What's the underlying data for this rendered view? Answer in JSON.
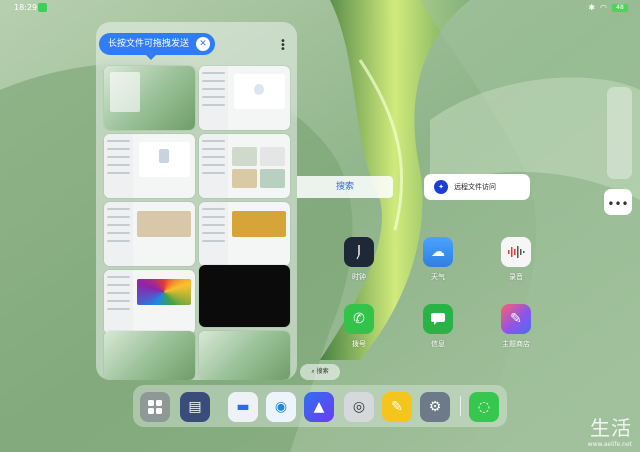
{
  "status_bar": {
    "time": "18:29",
    "battery": "48"
  },
  "file_panel": {
    "tooltip": "长按文件可拖拽发送",
    "close_symbol": "✕",
    "more_symbol": "⋮"
  },
  "search_top": "搜索",
  "remote_access": "远程文件访问",
  "apps": [
    {
      "label": "时钟",
      "icon": "clock-icon",
      "color": "#1f2837"
    },
    {
      "label": "天气",
      "icon": "weather-icon",
      "color": "#3c8ff0"
    },
    {
      "label": "录音",
      "icon": "recorder-icon",
      "color": "#f6f6f6"
    },
    {
      "label": "拨号",
      "icon": "phone-icon",
      "color": "#33c24a"
    },
    {
      "label": "信息",
      "icon": "message-icon",
      "color": "#28b347"
    },
    {
      "label": "主题商店",
      "icon": "theme-store-icon",
      "color": "#9d4ff0"
    }
  ],
  "search_pill": "搜索",
  "dock": [
    {
      "icon": "app-drawer-icon",
      "color": "#8e9896"
    },
    {
      "icon": "file-manager-icon",
      "color": "#3a4c7a"
    },
    {
      "icon": "files-icon",
      "color": "#eef2f6"
    },
    {
      "icon": "browser-icon",
      "color": "#eef4fb"
    },
    {
      "icon": "gallery-icon",
      "color": "#2f6ff3"
    },
    {
      "icon": "camera-icon",
      "color": "#d6d9dc"
    },
    {
      "icon": "notes-icon",
      "color": "#f4c51c"
    },
    {
      "icon": "settings-icon",
      "color": "#6d7a8a"
    },
    {
      "icon": "app-store-icon",
      "color": "#37c64e"
    }
  ],
  "watermark": {
    "text": "生活",
    "url": "www.aelife.net"
  }
}
